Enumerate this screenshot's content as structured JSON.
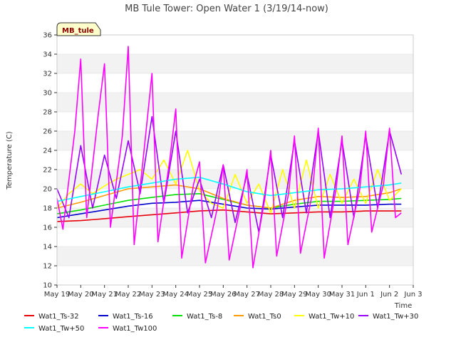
{
  "chart_data": {
    "type": "line",
    "title": "MB Tule Tower: Open Water 1 (3/19/14-now)",
    "xlabel": "Time",
    "ylabel": "Temperature (C)",
    "site_tag": "MB_tule",
    "ylim": [
      10,
      36
    ],
    "yticks": [
      10,
      12,
      14,
      16,
      18,
      20,
      22,
      24,
      26,
      28,
      30,
      32,
      34,
      36
    ],
    "xlim": [
      "2014-05-19",
      "2014-06-03"
    ],
    "xticks": [
      "May 19",
      "May 20",
      "May 21",
      "May 22",
      "May 23",
      "May 24",
      "May 25",
      "May 26",
      "May 27",
      "May 28",
      "May 29",
      "May 30",
      "May 31",
      "Jun 1",
      "Jun 2",
      "Jun 3"
    ],
    "grid": "horizontal bands",
    "legend_position": "bottom",
    "series": [
      {
        "name": "Wat1_Ts-32",
        "color": "#e8000b",
        "x": [
          "2014-05-19",
          "2014-05-20",
          "2014-05-21",
          "2014-05-22",
          "2014-05-23",
          "2014-05-24",
          "2014-05-25",
          "2014-05-26",
          "2014-05-27",
          "2014-05-28",
          "2014-05-29",
          "2014-05-30",
          "2014-05-31",
          "2014-06-01",
          "2014-06-02",
          "2014-06-02 12:00"
        ],
        "y": [
          16.6,
          16.7,
          16.9,
          17.1,
          17.3,
          17.5,
          17.7,
          17.8,
          17.6,
          17.4,
          17.5,
          17.6,
          17.6,
          17.7,
          17.7,
          17.7
        ]
      },
      {
        "name": "Wat1_Ts-16",
        "color": "#0000cc",
        "x": [
          "2014-05-19",
          "2014-05-20",
          "2014-05-21",
          "2014-05-22",
          "2014-05-23",
          "2014-05-24",
          "2014-05-25",
          "2014-05-26",
          "2014-05-27",
          "2014-05-28",
          "2014-05-29",
          "2014-05-30",
          "2014-05-31",
          "2014-06-01",
          "2014-06-02",
          "2014-06-02 12:00"
        ],
        "y": [
          17.0,
          17.4,
          17.8,
          18.2,
          18.5,
          18.6,
          18.8,
          18.4,
          18.0,
          17.9,
          18.1,
          18.3,
          18.3,
          18.3,
          18.4,
          18.4
        ]
      },
      {
        "name": "Wat1_Ts-8",
        "color": "#00e000",
        "x": [
          "2014-05-19",
          "2014-05-20",
          "2014-05-21",
          "2014-05-22",
          "2014-05-23",
          "2014-05-24",
          "2014-05-25",
          "2014-05-26",
          "2014-05-27",
          "2014-05-28",
          "2014-05-29",
          "2014-05-30",
          "2014-05-31",
          "2014-06-01",
          "2014-06-02",
          "2014-06-02 12:00"
        ],
        "y": [
          17.4,
          17.8,
          18.3,
          18.8,
          19.1,
          19.4,
          19.5,
          18.9,
          18.3,
          18.0,
          18.4,
          18.7,
          18.7,
          18.8,
          18.9,
          19.0
        ]
      },
      {
        "name": "Wat1_Ts0",
        "color": "#ff9900",
        "x": [
          "2014-05-19",
          "2014-05-20",
          "2014-05-21",
          "2014-05-22",
          "2014-05-23",
          "2014-05-24",
          "2014-05-25",
          "2014-05-26",
          "2014-05-27",
          "2014-05-28",
          "2014-05-29",
          "2014-05-30",
          "2014-05-31",
          "2014-06-01",
          "2014-06-02",
          "2014-06-02 12:00"
        ],
        "y": [
          18.0,
          18.6,
          19.3,
          20.0,
          20.2,
          20.4,
          20.0,
          19.0,
          18.3,
          18.0,
          18.8,
          19.2,
          19.1,
          19.2,
          19.6,
          20.0
        ]
      },
      {
        "name": "Wat1_Tw+10",
        "color": "#ffff00",
        "x": [
          "2014-05-19",
          "2014-05-19 12:00",
          "2014-05-20",
          "2014-05-20 12:00",
          "2014-05-21",
          "2014-05-21 12:00",
          "2014-05-22",
          "2014-05-22 12:00",
          "2014-05-23",
          "2014-05-23 12:00",
          "2014-05-24",
          "2014-05-24 12:00",
          "2014-05-25",
          "2014-05-25 12:00",
          "2014-05-26",
          "2014-05-26 12:00",
          "2014-05-27",
          "2014-05-27 12:00",
          "2014-05-28",
          "2014-05-28 12:00",
          "2014-05-29",
          "2014-05-29 12:00",
          "2014-05-30",
          "2014-05-30 12:00",
          "2014-05-31",
          "2014-05-31 12:00",
          "2014-06-01",
          "2014-06-01 12:00",
          "2014-06-02",
          "2014-06-02 12:00"
        ],
        "y": [
          18.0,
          19.5,
          20.5,
          19.5,
          20.3,
          21.0,
          21.5,
          22.0,
          21.0,
          23.0,
          20.5,
          24.0,
          19.8,
          18.5,
          18.0,
          21.5,
          18.5,
          20.5,
          17.5,
          22.0,
          18.0,
          23.0,
          18.0,
          21.5,
          18.5,
          21.0,
          18.5,
          22.0,
          18.8,
          20.0
        ]
      },
      {
        "name": "Wat1_Tw+30",
        "color": "#9900ff",
        "x": [
          "2014-05-19",
          "2014-05-19 12:00",
          "2014-05-20",
          "2014-05-20 12:00",
          "2014-05-21",
          "2014-05-21 12:00",
          "2014-05-22",
          "2014-05-22 12:00",
          "2014-05-23",
          "2014-05-23 12:00",
          "2014-05-24",
          "2014-05-24 12:00",
          "2014-05-25",
          "2014-05-25 12:00",
          "2014-05-26",
          "2014-05-26 12:00",
          "2014-05-27",
          "2014-05-27 12:00",
          "2014-05-28",
          "2014-05-28 12:00",
          "2014-05-29",
          "2014-05-29 12:00",
          "2014-05-30",
          "2014-05-30 12:00",
          "2014-05-31",
          "2014-05-31 12:00",
          "2014-06-01",
          "2014-06-01 12:00",
          "2014-06-02",
          "2014-06-02 12:00"
        ],
        "y": [
          20.0,
          17.0,
          24.5,
          18.0,
          23.5,
          19.0,
          25.0,
          19.5,
          27.5,
          18.5,
          26.0,
          17.5,
          21.0,
          17.0,
          22.5,
          16.5,
          21.5,
          15.5,
          23.5,
          17.0,
          25.0,
          17.5,
          26.0,
          17.0,
          25.0,
          17.0,
          25.5,
          18.0,
          26.0,
          21.5
        ]
      },
      {
        "name": "Wat1_Tw+50",
        "color": "#00ffff",
        "x": [
          "2014-05-19",
          "2014-05-20",
          "2014-05-21",
          "2014-05-22",
          "2014-05-23",
          "2014-05-24",
          "2014-05-25",
          "2014-05-26",
          "2014-05-27",
          "2014-05-28",
          "2014-05-29",
          "2014-05-30",
          "2014-05-31",
          "2014-06-01",
          "2014-06-02",
          "2014-06-02 12:00"
        ],
        "y": [
          18.7,
          19.2,
          19.7,
          20.2,
          20.6,
          21.0,
          21.2,
          20.5,
          19.7,
          19.3,
          19.6,
          19.9,
          20.0,
          20.2,
          20.4,
          20.6
        ]
      },
      {
        "name": "Wat1_Tw100",
        "color": "#ff00ff",
        "x": [
          "2014-05-19",
          "2014-05-19 06:00",
          "2014-05-19 18:00",
          "2014-05-20",
          "2014-05-20 06:00",
          "2014-05-20 18:00",
          "2014-05-21",
          "2014-05-21 06:00",
          "2014-05-21 18:00",
          "2014-05-22",
          "2014-05-22 06:00",
          "2014-05-22 18:00",
          "2014-05-23",
          "2014-05-23 06:00",
          "2014-05-23 18:00",
          "2014-05-24",
          "2014-05-24 06:00",
          "2014-05-24 18:00",
          "2014-05-25",
          "2014-05-25 06:00",
          "2014-05-25 18:00",
          "2014-05-26",
          "2014-05-26 06:00",
          "2014-05-26 18:00",
          "2014-05-27",
          "2014-05-27 06:00",
          "2014-05-27 18:00",
          "2014-05-28",
          "2014-05-28 06:00",
          "2014-05-28 18:00",
          "2014-05-29",
          "2014-05-29 06:00",
          "2014-05-29 18:00",
          "2014-05-30",
          "2014-05-30 06:00",
          "2014-05-30 18:00",
          "2014-05-31",
          "2014-05-31 06:00",
          "2014-05-31 18:00",
          "2014-06-01",
          "2014-06-01 06:00",
          "2014-06-01 18:00",
          "2014-06-02",
          "2014-06-02 06:00",
          "2014-06-02 12:00"
        ],
        "y": [
          19.0,
          15.8,
          26.0,
          33.5,
          17.0,
          28.0,
          33.0,
          16.0,
          25.5,
          34.8,
          14.2,
          26.0,
          32.0,
          14.5,
          23.0,
          28.3,
          12.8,
          20.5,
          22.8,
          12.3,
          18.0,
          22.5,
          12.6,
          18.5,
          22.0,
          11.8,
          19.0,
          24.0,
          13.0,
          19.5,
          25.5,
          13.3,
          19.5,
          26.3,
          12.8,
          20.0,
          25.5,
          14.2,
          20.0,
          26.0,
          15.5,
          20.5,
          26.3,
          17.0,
          17.5
        ]
      }
    ]
  }
}
